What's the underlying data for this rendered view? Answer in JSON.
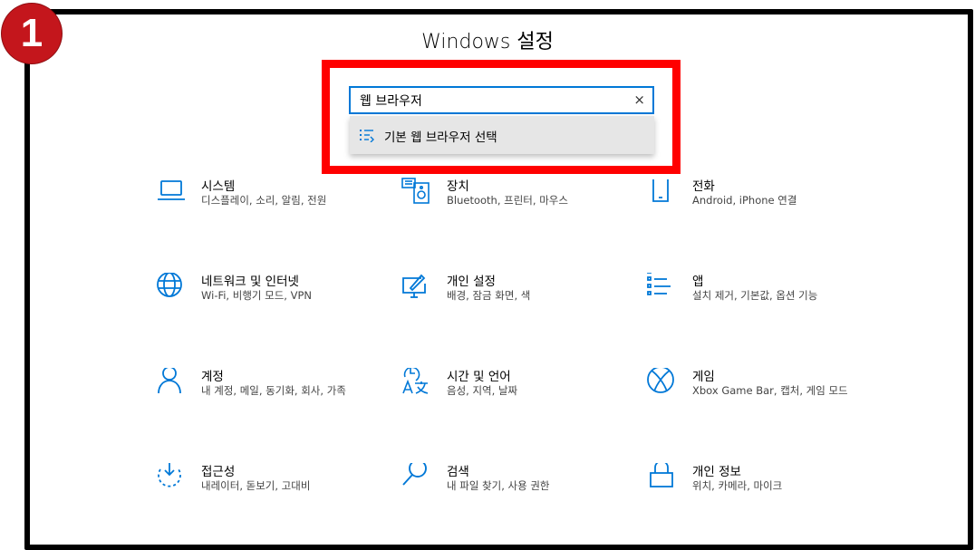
{
  "badge": "1",
  "window": {
    "title": "Windows 설정"
  },
  "search": {
    "value": "웹 브라우저",
    "clear_label": "×"
  },
  "suggestion": {
    "label": "기본 웹 브라우저 선택",
    "icon": "list-setting-icon"
  },
  "accent_color": "#0078d7",
  "highlight_color": "#ff0000",
  "tiles": [
    {
      "name": "시스템",
      "desc": "디스플레이, 소리, 알림, 전원",
      "icon": "laptop-icon"
    },
    {
      "name": "장치",
      "desc": "Bluetooth, 프린터, 마우스",
      "icon": "devices-icon"
    },
    {
      "name": "전화",
      "desc": "Android, iPhone 연결",
      "icon": "phone-icon"
    },
    {
      "name": "네트워크 및 인터넷",
      "desc": "Wi-Fi, 비행기 모드, VPN",
      "icon": "globe-icon"
    },
    {
      "name": "개인 설정",
      "desc": "배경, 잠금 화면, 색",
      "icon": "personalization-icon"
    },
    {
      "name": "앱",
      "desc": "설치 제거, 기본값, 옵션 기능",
      "icon": "apps-list-icon"
    },
    {
      "name": "계정",
      "desc": "내 계정, 메일, 동기화, 회사, 가족",
      "icon": "person-icon"
    },
    {
      "name": "시간 및 언어",
      "desc": "음성, 지역, 날짜",
      "icon": "time-language-icon"
    },
    {
      "name": "게임",
      "desc": "Xbox Game Bar, 캡처, 게임 모드",
      "icon": "xbox-icon"
    },
    {
      "name": "접근성",
      "desc": "내레이터, 돋보기, 고대비",
      "icon": "accessibility-icon"
    },
    {
      "name": "검색",
      "desc": "내 파일 찾기, 사용 권한",
      "icon": "search-icon"
    },
    {
      "name": "개인 정보",
      "desc": "위치, 카메라, 마이크",
      "icon": "lock-icon"
    }
  ]
}
